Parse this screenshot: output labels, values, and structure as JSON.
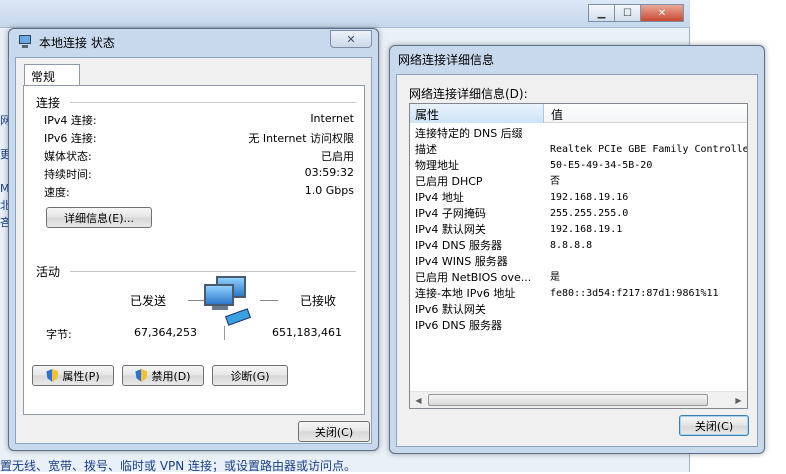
{
  "background": {
    "side_letters": [
      "网",
      "更",
      "M",
      "北",
      "吝"
    ],
    "bottom_text": "置无线、宽带、拨号、临时或 VPN 连接；或设置路由器或访问点。"
  },
  "dlg1": {
    "title": "本地连接 状态",
    "close_glyph": "✕",
    "tab": "常规",
    "connection": {
      "title": "连接",
      "rows": [
        {
          "label": "IPv4 连接:",
          "value": "Internet"
        },
        {
          "label": "IPv6 连接:",
          "value": "无 Internet 访问权限"
        },
        {
          "label": "媒体状态:",
          "value": "已启用"
        },
        {
          "label": "持续时间:",
          "value": "03:59:32"
        },
        {
          "label": "速度:",
          "value": "1.0 Gbps"
        }
      ],
      "details_button": "详细信息(E)..."
    },
    "activity": {
      "title": "活动",
      "sent_label": "已发送",
      "recv_label": "已接收",
      "bytes_label": "字节:",
      "bytes_sent": "67,364,253",
      "bytes_recv": "651,183,461"
    },
    "buttons": {
      "properties": "属性(P)",
      "disable": "禁用(D)",
      "diagnose": "诊断(G)",
      "close": "关闭(C)"
    }
  },
  "dlg2": {
    "title": "网络连接详细信息",
    "caption": "网络连接详细信息(D):",
    "headers": {
      "property": "属性",
      "value": "值"
    },
    "rows": [
      {
        "p": "连接特定的 DNS 后缀",
        "v": ""
      },
      {
        "p": "描述",
        "v": "Realtek PCIe GBE Family Controlle"
      },
      {
        "p": "物理地址",
        "v": "50-E5-49-34-5B-20"
      },
      {
        "p": "已启用 DHCP",
        "v": "否"
      },
      {
        "p": "IPv4 地址",
        "v": "192.168.19.16"
      },
      {
        "p": "IPv4 子网掩码",
        "v": "255.255.255.0"
      },
      {
        "p": "IPv4 默认网关",
        "v": "192.168.19.1"
      },
      {
        "p": "IPv4 DNS 服务器",
        "v": "8.8.8.8"
      },
      {
        "p": "IPv4 WINS 服务器",
        "v": ""
      },
      {
        "p": "已启用 NetBIOS ove...",
        "v": "是"
      },
      {
        "p": "连接-本地 IPv6 地址",
        "v": "fe80::3d54:f217:87d1:9861%11"
      },
      {
        "p": "IPv6 默认网关",
        "v": ""
      },
      {
        "p": "IPv6 DNS 服务器",
        "v": ""
      }
    ],
    "close_button": "关闭(C)"
  },
  "icons": {
    "minimize": "▁",
    "maximize": "☐",
    "close": "✕",
    "scroll_left": "◀",
    "scroll_right": "▶"
  }
}
